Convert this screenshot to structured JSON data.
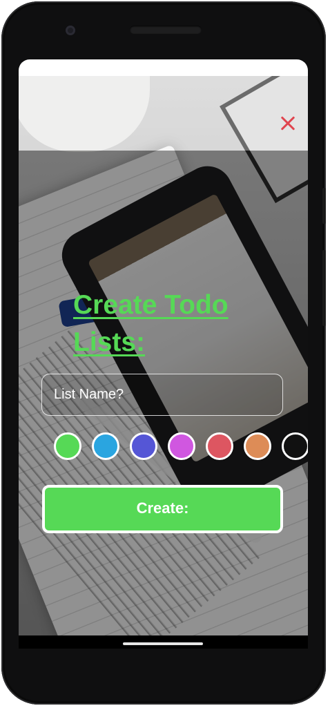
{
  "device": {
    "icons": [
      "front-camera",
      "earpiece-speaker",
      "gesture-bar"
    ]
  },
  "screen": {
    "title": "Create Todo Lists:",
    "close_icon": "close-x-icon",
    "name_input": {
      "placeholder": "List Name?",
      "value": ""
    },
    "colors": [
      {
        "name": "green",
        "hex": "#56d956",
        "selected": true
      },
      {
        "name": "blue",
        "hex": "#2aa5e0",
        "selected": false
      },
      {
        "name": "indigo",
        "hex": "#5556d6",
        "selected": false
      },
      {
        "name": "violet",
        "hex": "#d057e0",
        "selected": false
      },
      {
        "name": "red",
        "hex": "#dd5661",
        "selected": false
      },
      {
        "name": "orange",
        "hex": "#dd8c57",
        "selected": false
      },
      {
        "name": "black",
        "hex": "#111111",
        "selected": false
      }
    ],
    "create_button_label": "Create:",
    "accent_color": "#56d956",
    "close_color": "#e0454f"
  }
}
